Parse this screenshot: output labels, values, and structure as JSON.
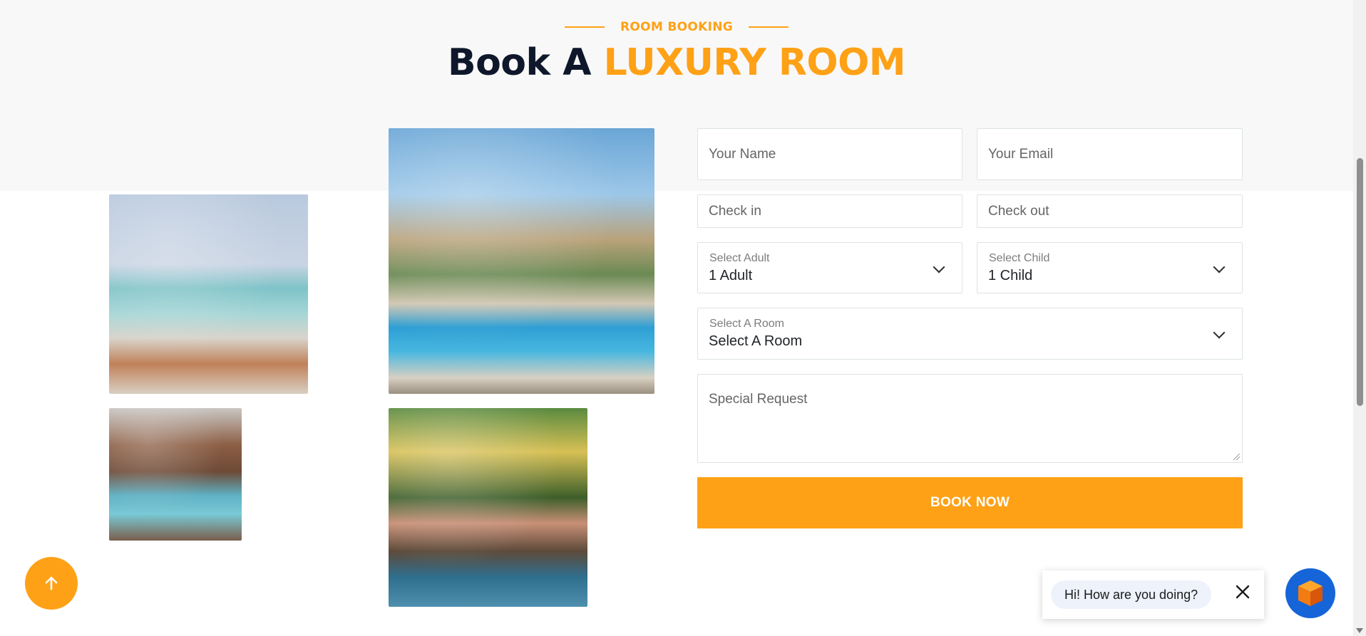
{
  "section": {
    "eyebrow": "ROOM BOOKING",
    "title_main": "Book A",
    "title_accent": "LUXURY ROOM"
  },
  "form": {
    "name_placeholder": "Your Name",
    "email_placeholder": "Your Email",
    "checkin_placeholder": "Check in",
    "checkout_placeholder": "Check out",
    "adult": {
      "label": "Select Adult",
      "value": "1 Adult"
    },
    "child": {
      "label": "Select Child",
      "value": "1 Child"
    },
    "room": {
      "label": "Select A Room",
      "value": "Select A Room"
    },
    "request_placeholder": "Special Request",
    "submit_label": "BOOK NOW"
  },
  "chat": {
    "greeting": "Hi! How are you doing?"
  },
  "colors": {
    "accent": "#fea116",
    "heading": "#0f172b",
    "chat_launcher": "#1565d8"
  },
  "icons": [
    "arrow-up-icon",
    "close-icon",
    "chat-cube-icon",
    "chevron-down-icon"
  ]
}
